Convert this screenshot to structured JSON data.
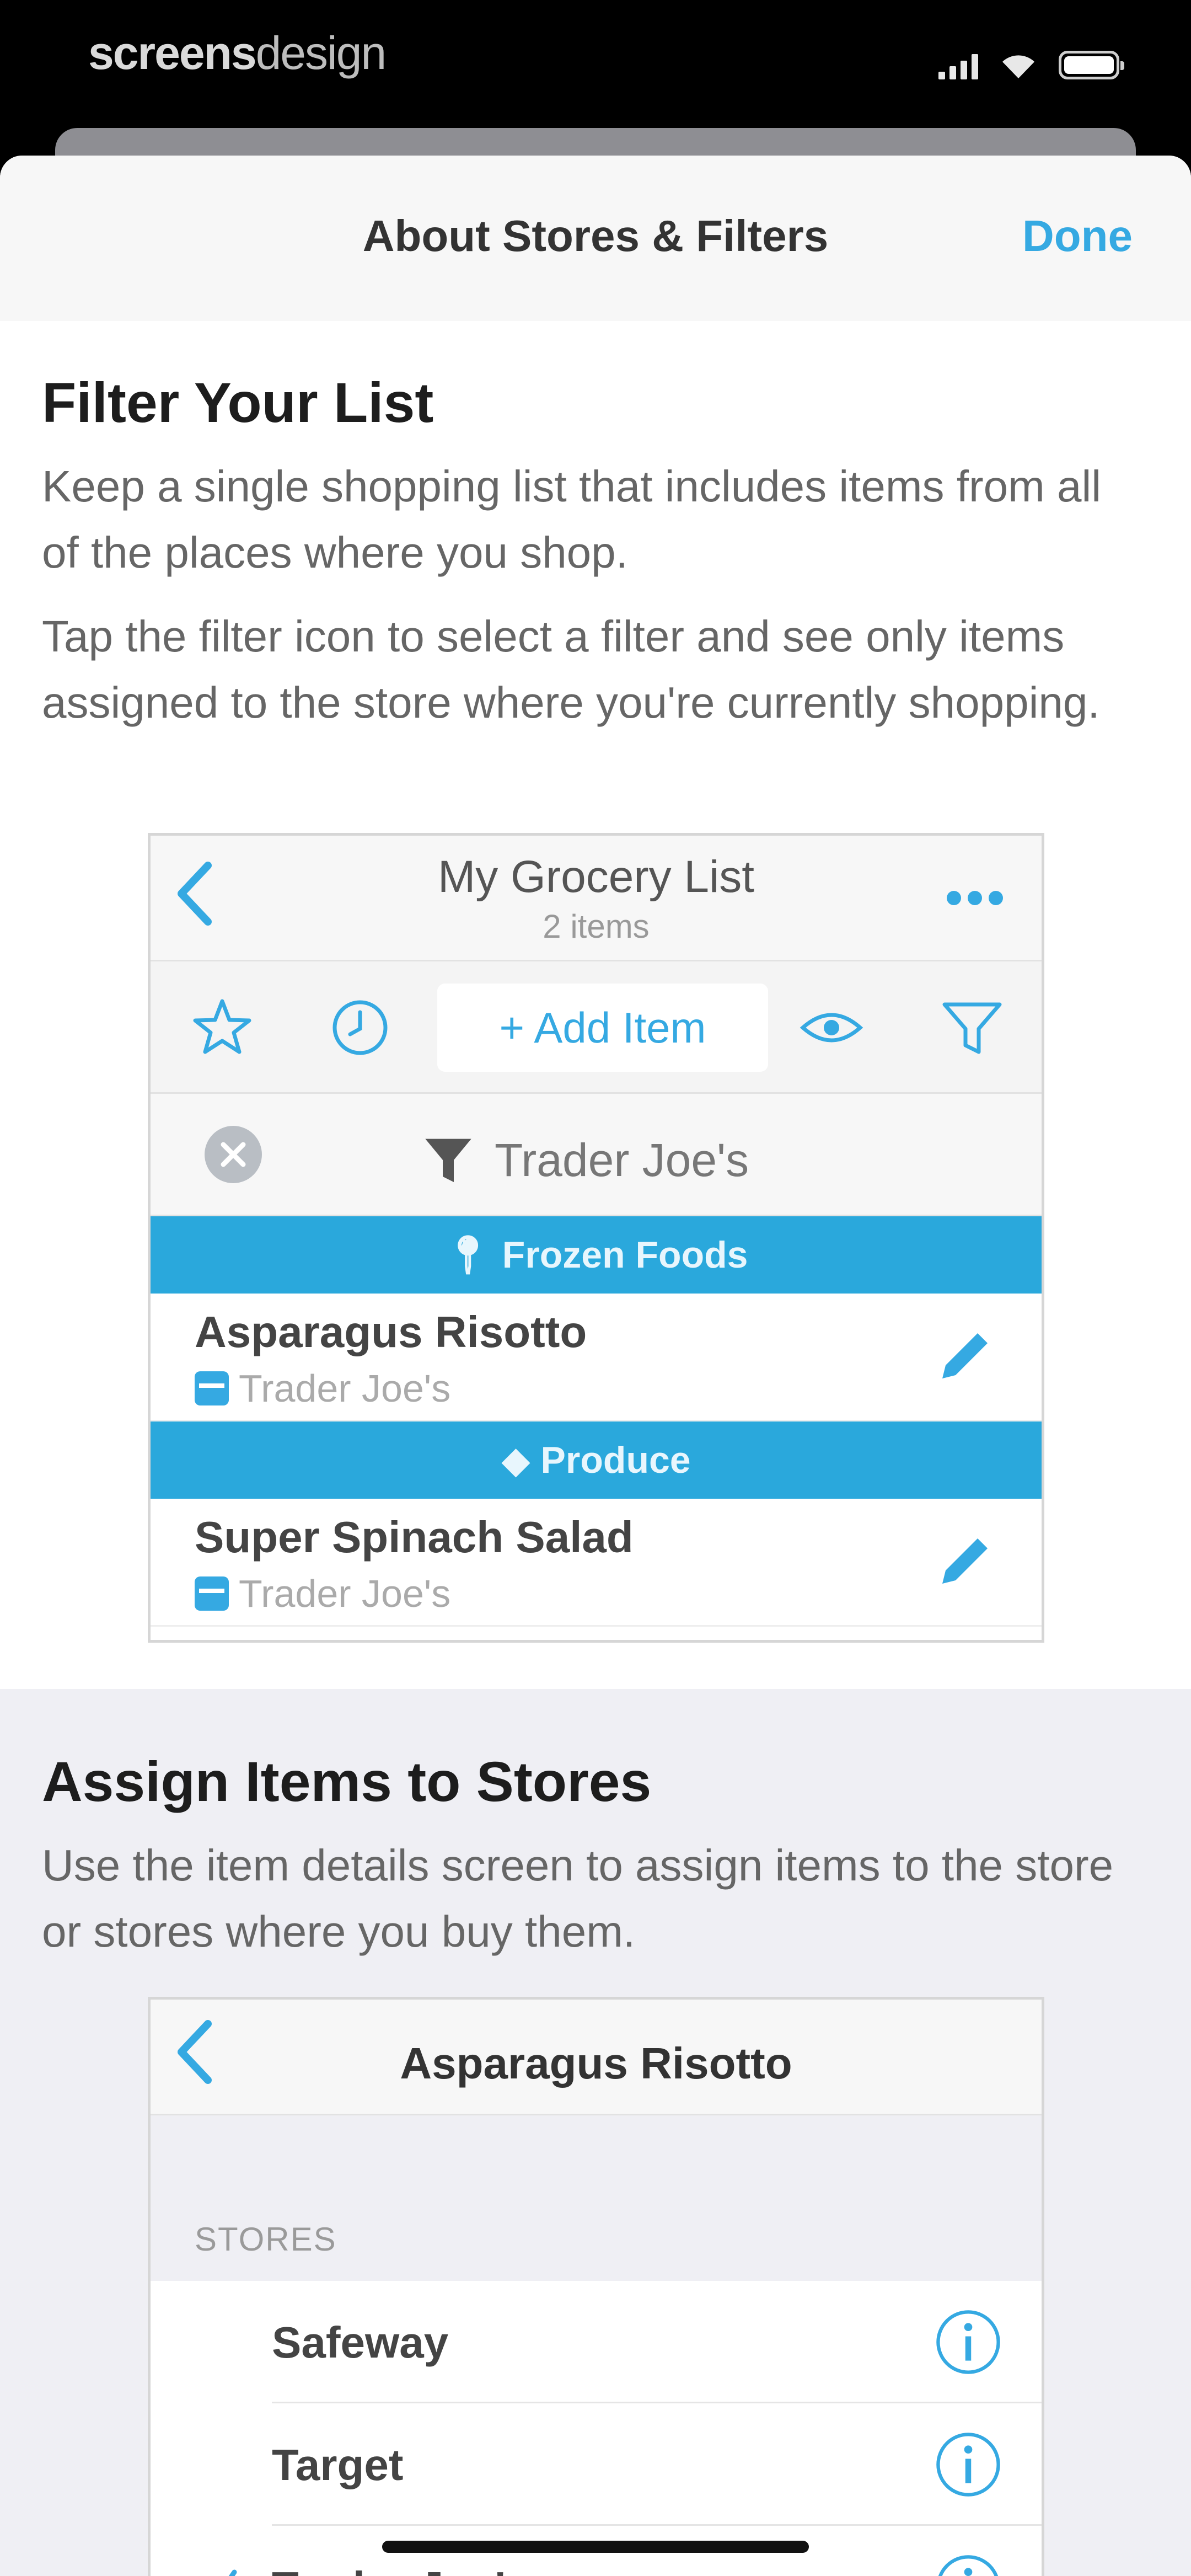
{
  "status_bar": {
    "carrier_bold": "screens",
    "carrier_light": "design"
  },
  "nav": {
    "title": "About Stores & Filters",
    "done_label": "Done"
  },
  "section_filter": {
    "title": "Filter Your List",
    "paragraph1": "Keep a single shopping list that includes items from all of the places where you shop.",
    "paragraph2": "Tap the filter icon to select a filter and see only items assigned to the store where you're currently shopping."
  },
  "mock_list": {
    "title": "My Grocery List",
    "subtitle": "2 items",
    "add_item_label": "+ Add Item",
    "filter_store": "Trader Joe's",
    "icons": [
      "back-chevron-icon",
      "more-dots-icon",
      "star-icon",
      "clock-icon",
      "eye-icon",
      "filter-icon",
      "clear-icon",
      "pencil-icon",
      "store-icon"
    ],
    "categories": [
      {
        "label": "Frozen Foods",
        "item": "Asparagus Risotto",
        "store": "Trader Joe's"
      },
      {
        "label": "Produce",
        "item": "Super Spinach Salad",
        "store": "Trader Joe's"
      }
    ]
  },
  "section_assign": {
    "title": "Assign Items to Stores",
    "paragraph": "Use the item details screen to assign items to the store or stores where you buy them."
  },
  "mock_details": {
    "title": "Asparagus Risotto",
    "stores_header": "STORES",
    "stores": [
      {
        "name": "Safeway",
        "checked": false
      },
      {
        "name": "Target",
        "checked": false
      },
      {
        "name": "Trader Joe's",
        "checked": true
      }
    ]
  },
  "colors": {
    "accent": "#35a9e2",
    "category_bar": "#2aa8dc"
  }
}
